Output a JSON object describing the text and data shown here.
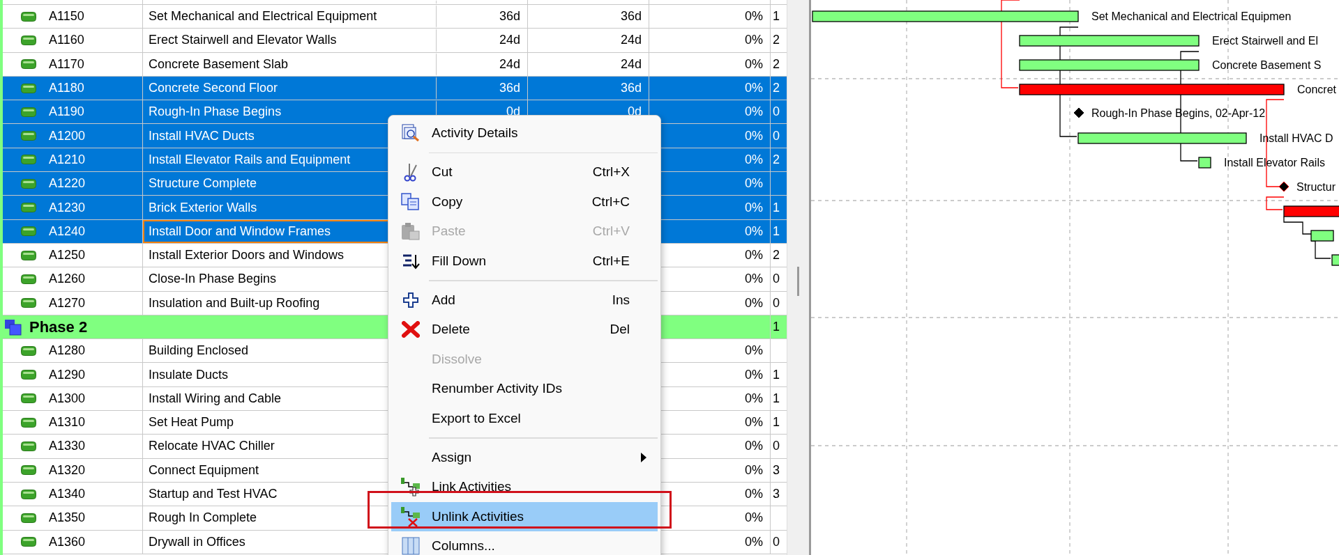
{
  "table": {
    "rows": [
      {
        "kind": "activity",
        "id": "A1150",
        "name": "Set Mechanical and Electrical Equipment",
        "original_duration": "36d",
        "remaining_duration": "36d",
        "percent": "0%",
        "column_6": "1",
        "selected": false,
        "focused": false
      },
      {
        "kind": "activity",
        "id": "A1160",
        "name": "Erect Stairwell and Elevator Walls",
        "original_duration": "24d",
        "remaining_duration": "24d",
        "percent": "0%",
        "column_6": "2",
        "selected": false,
        "focused": false
      },
      {
        "kind": "activity",
        "id": "A1170",
        "name": "Concrete Basement Slab",
        "original_duration": "24d",
        "remaining_duration": "24d",
        "percent": "0%",
        "column_6": "2",
        "selected": false,
        "focused": false
      },
      {
        "kind": "activity",
        "id": "A1180",
        "name": "Concrete Second Floor",
        "original_duration": "36d",
        "remaining_duration": "36d",
        "percent": "0%",
        "column_6": "2",
        "selected": true,
        "focused": false
      },
      {
        "kind": "activity",
        "id": "A1190",
        "name": "Rough-In Phase Begins",
        "original_duration": "0d",
        "remaining_duration": "0d",
        "percent": "0%",
        "column_6": "0",
        "selected": true,
        "focused": false
      },
      {
        "kind": "activity",
        "id": "A1200",
        "name": "Install HVAC Ducts",
        "percent": "0%",
        "column_6": "0",
        "selected": true,
        "focused": false
      },
      {
        "kind": "activity",
        "id": "A1210",
        "name": "Install Elevator Rails and Equipment",
        "percent": "0%",
        "column_6": "2",
        "selected": true,
        "focused": false
      },
      {
        "kind": "activity",
        "id": "A1220",
        "name": "Structure Complete",
        "percent": "0%",
        "selected": true,
        "focused": false
      },
      {
        "kind": "activity",
        "id": "A1230",
        "name": "Brick Exterior Walls",
        "percent": "0%",
        "column_6": "1",
        "selected": true,
        "focused": false
      },
      {
        "kind": "activity",
        "id": "A1240",
        "name": "Install Door and Window Frames",
        "percent": "0%",
        "column_6": "1",
        "selected": true,
        "focused": true
      },
      {
        "kind": "activity",
        "id": "A1250",
        "name": "Install Exterior Doors and Windows",
        "percent": "0%",
        "column_6": "2",
        "selected": false,
        "focused": false
      },
      {
        "kind": "activity",
        "id": "A1260",
        "name": "Close-In Phase Begins",
        "percent": "0%",
        "column_6": "0",
        "selected": false,
        "focused": false
      },
      {
        "kind": "activity",
        "id": "A1270",
        "name": "Insulation and Built-up Roofing",
        "percent": "0%",
        "column_6": "0",
        "selected": false,
        "focused": false
      },
      {
        "kind": "wbs",
        "name": "Phase 2",
        "column_6": "1",
        "selected": false
      },
      {
        "kind": "activity",
        "id": "A1280",
        "name": "Building Enclosed",
        "percent": "0%",
        "selected": false,
        "focused": false
      },
      {
        "kind": "activity",
        "id": "A1290",
        "name": "Insulate Ducts",
        "percent": "0%",
        "column_6": "1",
        "selected": false,
        "focused": false
      },
      {
        "kind": "activity",
        "id": "A1300",
        "name": "Install Wiring and Cable",
        "percent": "0%",
        "column_6": "1",
        "selected": false,
        "focused": false
      },
      {
        "kind": "activity",
        "id": "A1310",
        "name": "Set Heat Pump",
        "percent": "0%",
        "column_6": "1",
        "selected": false,
        "focused": false
      },
      {
        "kind": "activity",
        "id": "A1330",
        "name": "Relocate HVAC Chiller",
        "percent": "0%",
        "column_6": "0",
        "selected": false,
        "focused": false
      },
      {
        "kind": "activity",
        "id": "A1320",
        "name": "Connect Equipment",
        "percent": "0%",
        "column_6": "3",
        "selected": false,
        "focused": false
      },
      {
        "kind": "activity",
        "id": "A1340",
        "name": "Startup and Test HVAC",
        "percent": "0%",
        "column_6": "3",
        "selected": false,
        "focused": false
      },
      {
        "kind": "activity",
        "id": "A1350",
        "name": "Rough In Complete",
        "percent": "0%",
        "selected": false,
        "focused": false
      },
      {
        "kind": "activity",
        "id": "A1360",
        "name": "Drywall in Offices",
        "percent": "0%",
        "column_6": "0",
        "selected": false,
        "focused": false
      }
    ]
  },
  "gantt": {
    "bars": [
      {
        "kind": "bar",
        "label": "Set Mechanical and Electrical Equipmen",
        "critical": false
      },
      {
        "kind": "bar",
        "label": "Erect Stairwell and El",
        "critical": false
      },
      {
        "kind": "bar",
        "label": "Concrete Basement S",
        "critical": false
      },
      {
        "kind": "bar",
        "label": "Concret",
        "critical": true
      },
      {
        "kind": "milestone",
        "label": "Rough-In Phase Begins, 02-Apr-12",
        "critical": false
      },
      {
        "kind": "bar",
        "label": "Install HVAC D",
        "critical": false
      },
      {
        "kind": "bar",
        "label": "Install Elevator Rails",
        "critical": false
      },
      {
        "kind": "milestone",
        "label": "Structur",
        "critical": true
      },
      {
        "kind": "bar",
        "critical": true
      },
      {
        "kind": "bar",
        "critical": false
      },
      {
        "kind": "bar",
        "critical": false
      }
    ]
  },
  "context_menu": {
    "items": [
      {
        "kind": "item",
        "label": "Activity Details",
        "disabled": false,
        "selected": false
      },
      {
        "kind": "separator"
      },
      {
        "kind": "item",
        "label": "Cut",
        "shortcut": "Ctrl+X",
        "disabled": false,
        "selected": false
      },
      {
        "kind": "item",
        "label": "Copy",
        "shortcut": "Ctrl+C",
        "disabled": false,
        "selected": false
      },
      {
        "kind": "item",
        "label": "Paste",
        "shortcut": "Ctrl+V",
        "disabled": true,
        "selected": false
      },
      {
        "kind": "item",
        "label": "Fill Down",
        "shortcut": "Ctrl+E",
        "disabled": false,
        "selected": false
      },
      {
        "kind": "separator"
      },
      {
        "kind": "item",
        "label": "Add",
        "shortcut": "Ins",
        "disabled": false,
        "selected": false
      },
      {
        "kind": "item",
        "label": "Delete",
        "shortcut": "Del",
        "disabled": false,
        "selected": false
      },
      {
        "kind": "item",
        "label": "Dissolve",
        "disabled": true,
        "selected": false
      },
      {
        "kind": "item",
        "label": "Renumber Activity IDs",
        "disabled": false,
        "selected": false
      },
      {
        "kind": "item",
        "label": "Export to Excel",
        "disabled": false,
        "selected": false
      },
      {
        "kind": "separator"
      },
      {
        "kind": "submenu",
        "label": "Assign",
        "disabled": false,
        "selected": false
      },
      {
        "kind": "item",
        "label": "Link Activities",
        "disabled": false,
        "selected": false
      },
      {
        "kind": "item",
        "label": "Unlink Activities",
        "disabled": false,
        "selected": true
      },
      {
        "kind": "item",
        "label": "Columns...",
        "disabled": false,
        "selected": false
      }
    ]
  }
}
